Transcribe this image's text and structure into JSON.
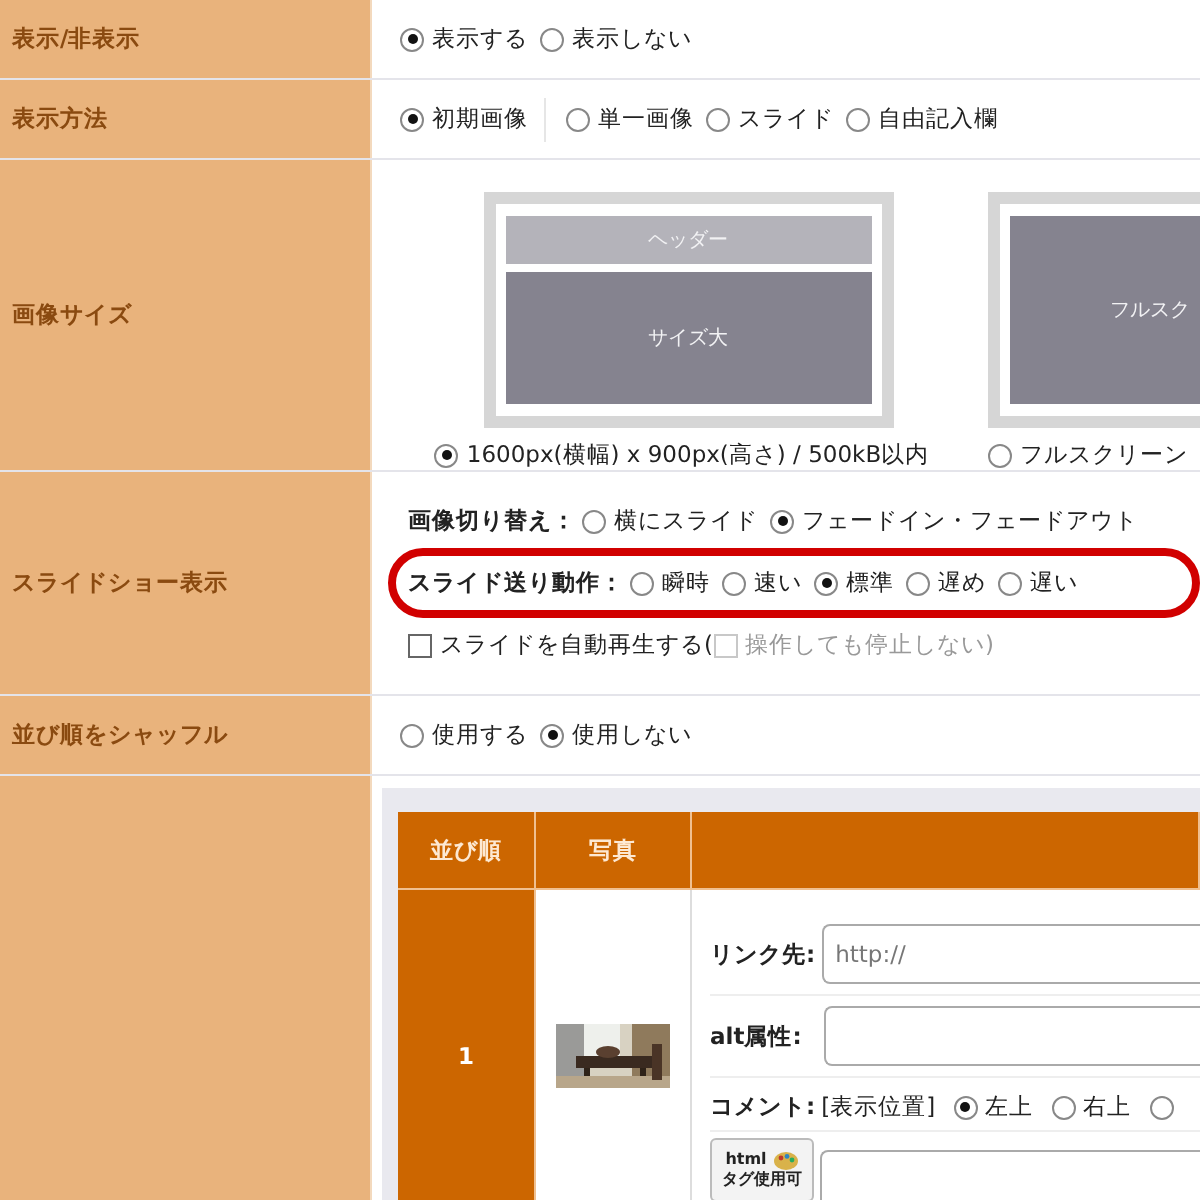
{
  "rows": [
    {
      "kind": "radios",
      "label": "表示/非表示",
      "options": [
        {
          "label": "表示する",
          "selected": true
        },
        {
          "label": "表示しない",
          "selected": false
        }
      ]
    },
    {
      "kind": "radios",
      "label": "表示方法",
      "options": [
        {
          "label": "初期画像",
          "selected": true
        },
        {
          "label": "単一画像",
          "selected": false
        },
        {
          "label": "スライド",
          "selected": false
        },
        {
          "label": "自由記入欄",
          "selected": false
        }
      ]
    },
    {
      "kind": "sizes",
      "label": "画像サイズ",
      "options": [
        {
          "preview": [
            "ヘッダー",
            "サイズ大"
          ],
          "label": "1600px(横幅) x 900px(高さ) / 500kB以内",
          "selected": true
        },
        {
          "preview": [
            "フルスク"
          ],
          "label": "フルスクリーン",
          "selected": false
        }
      ]
    },
    {
      "kind": "slideshow",
      "label": "スライドショー表示",
      "switch": {
        "label": "画像切り替え：",
        "options": [
          {
            "label": "横にスライド",
            "selected": false
          },
          {
            "label": "フェードイン・フェードアウト",
            "selected": true
          }
        ]
      },
      "speed": {
        "label": "スライド送り動作：",
        "highlighted": true,
        "options": [
          {
            "label": "瞬時",
            "selected": false
          },
          {
            "label": "速い",
            "selected": false
          },
          {
            "label": "標準",
            "selected": true
          },
          {
            "label": "遅め",
            "selected": false
          },
          {
            "label": "遅い",
            "selected": false
          }
        ]
      },
      "autoplay": {
        "label": "スライドを自動再生する(",
        "checked": false,
        "sub": {
          "label": "操作しても停止しない)",
          "checked": false,
          "disabled": true
        }
      }
    },
    {
      "kind": "radios",
      "label": "並び順をシャッフル",
      "options": [
        {
          "label": "使用する",
          "selected": false
        },
        {
          "label": "使用しない",
          "selected": true
        }
      ]
    },
    {
      "kind": "table",
      "columns": [
        "並び順",
        "写真"
      ],
      "items": [
        {
          "number": "1",
          "photo": {
            "kind": "picture"
          },
          "link": {
            "label": "リンク先:",
            "placeholder": "http://"
          },
          "alt": {
            "label": "alt属性:"
          },
          "comment": {
            "label": "コメント:",
            "position_label": "[表示位置]",
            "options": [
              {
                "label": "左上",
                "selected": true
              },
              {
                "label": "右上",
                "selected": false
              },
              {
                "selected": false
              }
            ]
          },
          "html_badge": [
            "html",
            "タグ使用可"
          ]
        }
      ]
    }
  ]
}
